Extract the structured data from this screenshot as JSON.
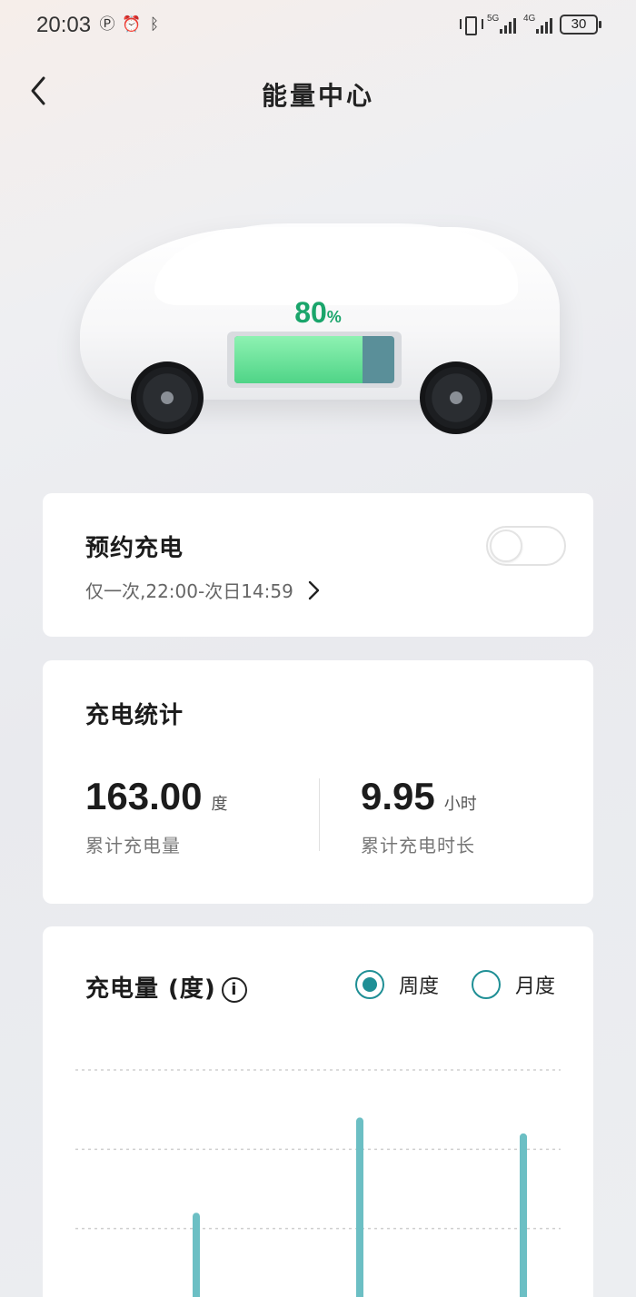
{
  "status_bar": {
    "time": "20:03",
    "battery": "30",
    "signal_1_label": "5G",
    "signal_2_label": "4G",
    "icons": [
      "nfc-icon",
      "alarm-icon",
      "bluetooth-icon",
      "vibrate-icon"
    ]
  },
  "header": {
    "title": "能量中心",
    "back_icon": "chevron-left-icon"
  },
  "vehicle": {
    "battery_level_percent": 80,
    "battery_percent_text": "80",
    "percent_sign": "%",
    "colors": {
      "charge": "#4fd487",
      "remaining": "#5a8f99",
      "label": "#1aa56b"
    }
  },
  "schedule": {
    "title": "预约充电",
    "detail": "仅一次,22:00-次日14:59",
    "enabled": false
  },
  "stats": {
    "title": "充电统计",
    "energy_value": "163.00",
    "energy_unit": "度",
    "energy_label": "累计充电量",
    "duration_value": "9.95",
    "duration_unit": "小时",
    "duration_label": "累计充电时长"
  },
  "chart_section": {
    "title": "充电量 (度)",
    "info_icon": "i",
    "period_options": [
      "周度",
      "月度"
    ],
    "selected_period": "周度",
    "accent_color": "#1f8f95"
  },
  "chart_data": {
    "type": "bar",
    "bar_color": "#6cbfc4",
    "values": [
      30,
      60,
      55
    ],
    "ylim": [
      0,
      75
    ],
    "grid": true,
    "gridline_values": [
      75,
      50,
      25
    ]
  }
}
